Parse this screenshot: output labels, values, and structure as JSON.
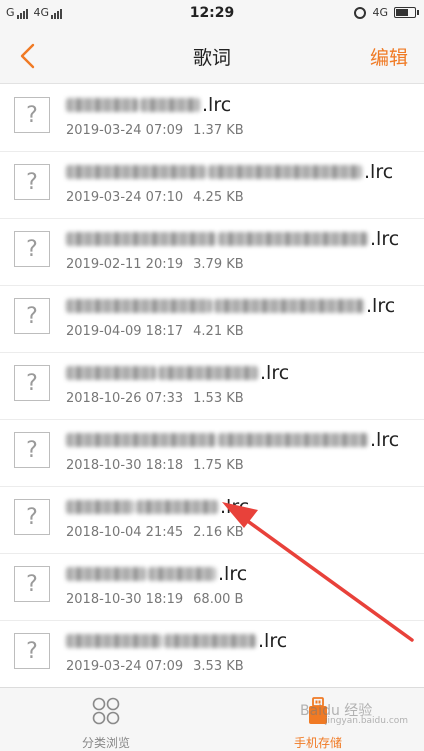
{
  "status_bar": {
    "carrier_left": "G",
    "carrier_right": "4G",
    "time": "12:29",
    "network": "4G"
  },
  "header": {
    "title": "歌词",
    "edit_label": "编辑"
  },
  "files": [
    {
      "extension": ".lrc",
      "date": "2019-03-24 07:09",
      "size": "1.37 KB",
      "icon": "unknown-file-icon"
    },
    {
      "extension": ".lrc",
      "date": "2019-03-24 07:10",
      "size": "4.25 KB",
      "icon": "unknown-file-icon"
    },
    {
      "extension": ".lrc",
      "date": "2019-02-11 20:19",
      "size": "3.79 KB",
      "icon": "unknown-file-icon"
    },
    {
      "extension": ".lrc",
      "date": "2019-04-09 18:17",
      "size": "4.21 KB",
      "icon": "unknown-file-icon"
    },
    {
      "extension": ".lrc",
      "date": "2018-10-26 07:33",
      "size": "1.53 KB",
      "icon": "unknown-file-icon"
    },
    {
      "extension": ".lrc",
      "date": "2018-10-30 18:18",
      "size": "1.75 KB",
      "icon": "unknown-file-icon"
    },
    {
      "extension": ".lrc",
      "date": "2018-10-04 21:45",
      "size": "2.16 KB",
      "icon": "unknown-file-icon"
    },
    {
      "extension": ".lrc",
      "date": "2018-10-30 18:19",
      "size": "68.00 B",
      "icon": "unknown-file-icon"
    },
    {
      "extension": ".lrc",
      "date": "2019-03-24 07:09",
      "size": "3.53 KB",
      "icon": "unknown-file-icon"
    }
  ],
  "bottom_nav": {
    "browse_label": "分类浏览",
    "storage_label": "手机存储"
  },
  "watermark": {
    "text": "Baidu 经验",
    "sub": "jingyan.baidu.com"
  },
  "colors": {
    "accent": "#f07a24",
    "arrow": "#e8413a"
  }
}
